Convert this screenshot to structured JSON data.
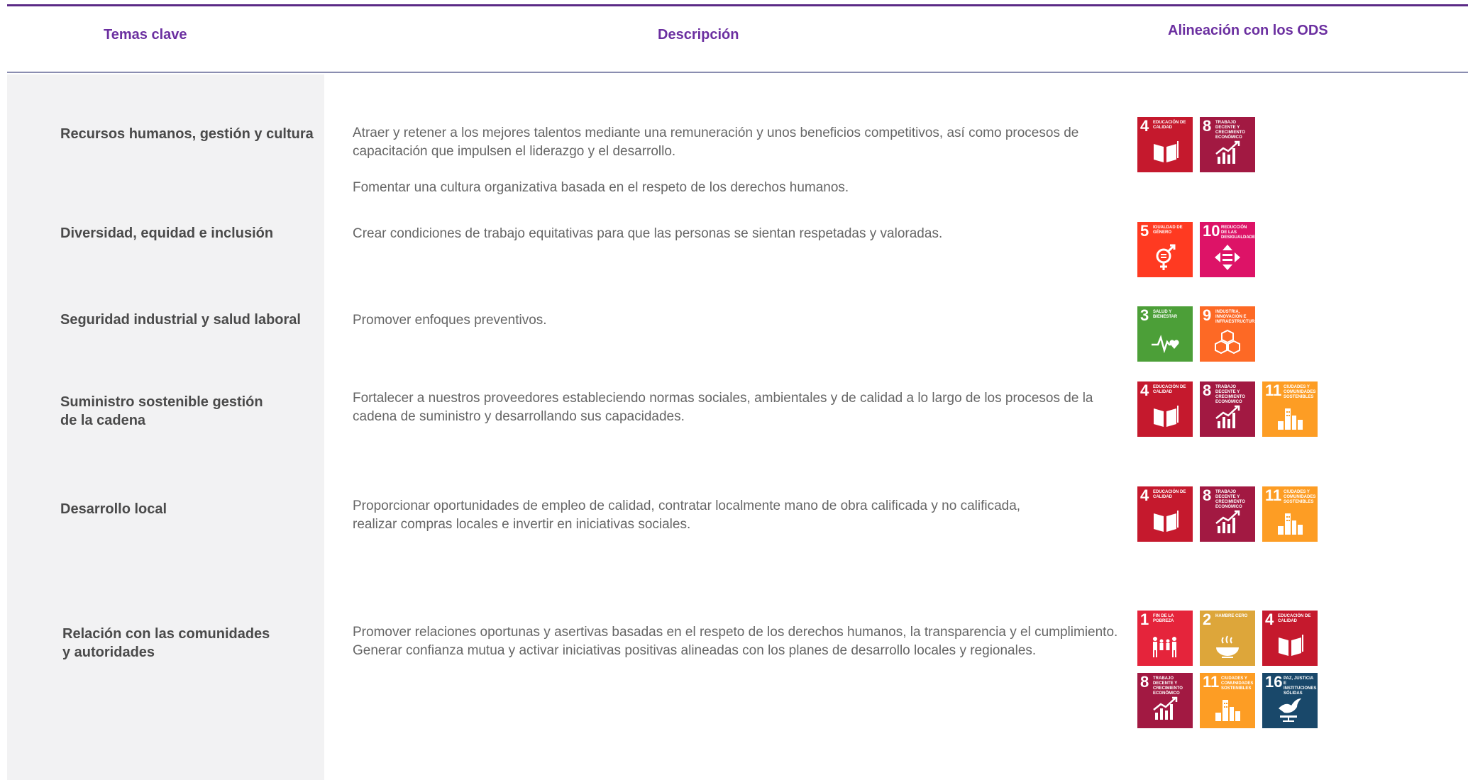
{
  "header": {
    "temas": "Temas clave",
    "descripcion": "Descripción",
    "ods": "Alineación con los ODS"
  },
  "rows": [
    {
      "tema": "Recursos humanos, gestión y cultura",
      "desc1": "Atraer y retener a los mejores talentos mediante una remuneración y unos beneficios competitivos, así como procesos de",
      "desc2": "capacitación que impulsen el liderazgo y el desarrollo.",
      "desc3": "Fomentar una cultura organizativa basada en el respeto de los derechos humanos."
    },
    {
      "tema": "Diversidad, equidad e inclusión",
      "desc1": "Crear condiciones de trabajo equitativas para que las personas se sientan respetadas y valoradas."
    },
    {
      "tema": "Seguridad industrial y salud laboral",
      "desc1": "Promover enfoques preventivos."
    },
    {
      "tema1": "Suministro sostenible gestión",
      "tema2": "de la cadena",
      "desc1": "Fortalecer a nuestros proveedores estableciendo normas sociales, ambientales y de calidad a lo largo de los procesos de la",
      "desc2": "cadena de suministro y desarrollando sus capacidades."
    },
    {
      "tema": "Desarrollo local",
      "desc1": "Proporcionar oportunidades de empleo de calidad, contratar localmente mano de obra calificada y no calificada,",
      "desc2": "realizar compras locales e invertir en iniciativas sociales."
    },
    {
      "tema1": "Relación con las comunidades",
      "tema2": "y autoridades",
      "desc1": "Promover relaciones oportunas y asertivas basadas en el respeto de los derechos humanos, la transparencia y el cumplimiento.",
      "desc2": "Generar confianza mutua y activar iniciativas positivas alineadas con los planes de desarrollo locales y regionales."
    }
  ],
  "sdg": {
    "1": {
      "num": "1",
      "label": "Fin de la pobreza",
      "color": "#e5243b",
      "icon": "family-icon"
    },
    "2": {
      "num": "2",
      "label": "Hambre cero",
      "color": "#dda63a",
      "icon": "bowl-icon"
    },
    "3": {
      "num": "3",
      "label": "Salud y bienestar",
      "color": "#4c9f38",
      "icon": "heartbeat-icon"
    },
    "4": {
      "num": "4",
      "label": "Educación de calidad",
      "color": "#c5192d",
      "icon": "book-icon"
    },
    "5": {
      "num": "5",
      "label": "Igualdad de género",
      "color": "#ff3a21",
      "icon": "gender-icon"
    },
    "8": {
      "num": "8",
      "label": "Trabajo decente y crecimiento económico",
      "color": "#a21942",
      "icon": "growth-chart-icon"
    },
    "9": {
      "num": "9",
      "label": "Industria, innovación e infraestructura",
      "color": "#fd6925",
      "icon": "cubes-icon"
    },
    "10": {
      "num": "10",
      "label": "Reducción de las desigualdades",
      "color": "#dd1367",
      "icon": "equal-arrows-icon"
    },
    "11": {
      "num": "11",
      "label": "Ciudades y comunidades sostenibles",
      "color": "#fd9d24",
      "icon": "city-icon"
    },
    "16": {
      "num": "16",
      "label": "Paz, justicia e instituciones sólidas",
      "color": "#19486a",
      "icon": "dove-icon"
    }
  }
}
